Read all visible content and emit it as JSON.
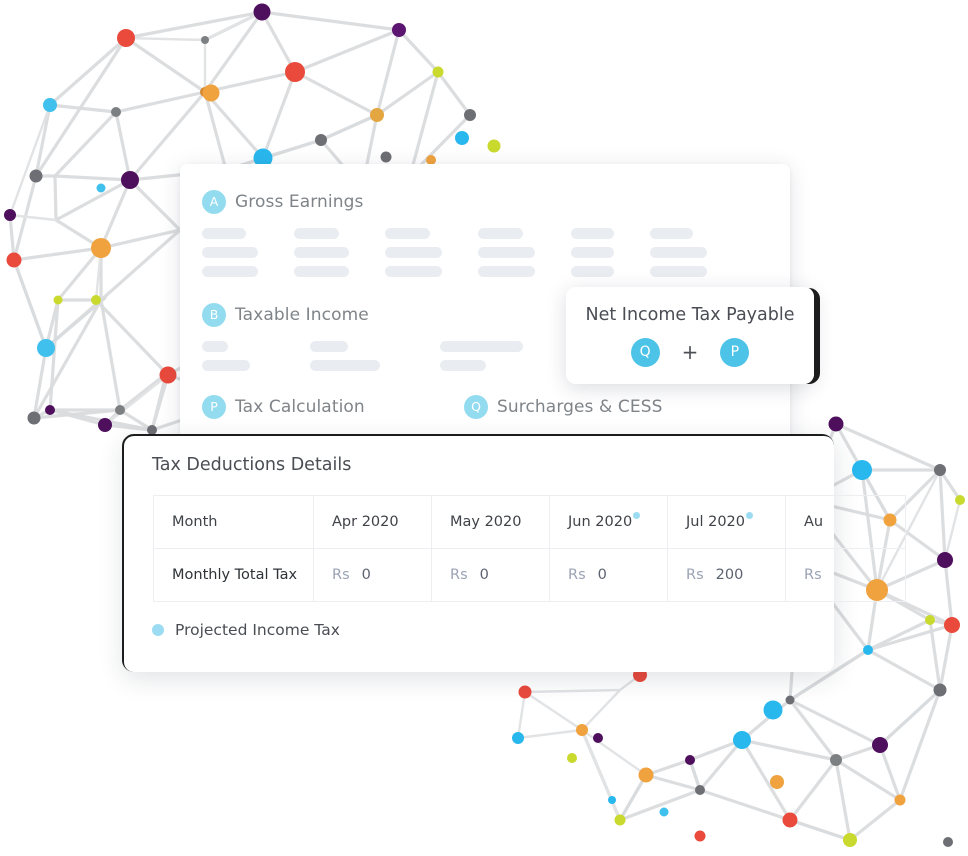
{
  "payslip": {
    "sections": [
      {
        "badge": "A",
        "title": "Gross Earnings"
      },
      {
        "badge": "B",
        "title": "Taxable Income"
      },
      {
        "badge": "P",
        "title": "Tax Calculation"
      },
      {
        "badge": "Q",
        "title": "Surcharges & CESS"
      }
    ]
  },
  "net_tax_card": {
    "title": "Net Income Tax Payable",
    "operand_left": "Q",
    "operator": "+",
    "operand_right": "P"
  },
  "deductions": {
    "title": "Tax Deductions Details",
    "columns": [
      "Month",
      "Apr 2020",
      "May 2020",
      "Jun 2020",
      "Jul 2020",
      "Au"
    ],
    "column_dots": [
      false,
      false,
      false,
      true,
      true,
      false
    ],
    "row_label": "Monthly Total Tax",
    "currency": "Rs",
    "values": [
      "0",
      "0",
      "0",
      "200",
      ""
    ],
    "legend": {
      "label": "Projected Income Tax",
      "color": "#9cdcf2"
    }
  },
  "colors": {
    "badge_blue": "#93dcf2",
    "chip_blue": "#4ec3e8",
    "skeleton": "#e9ecf1",
    "outline_black": "#1d1d1d"
  }
}
